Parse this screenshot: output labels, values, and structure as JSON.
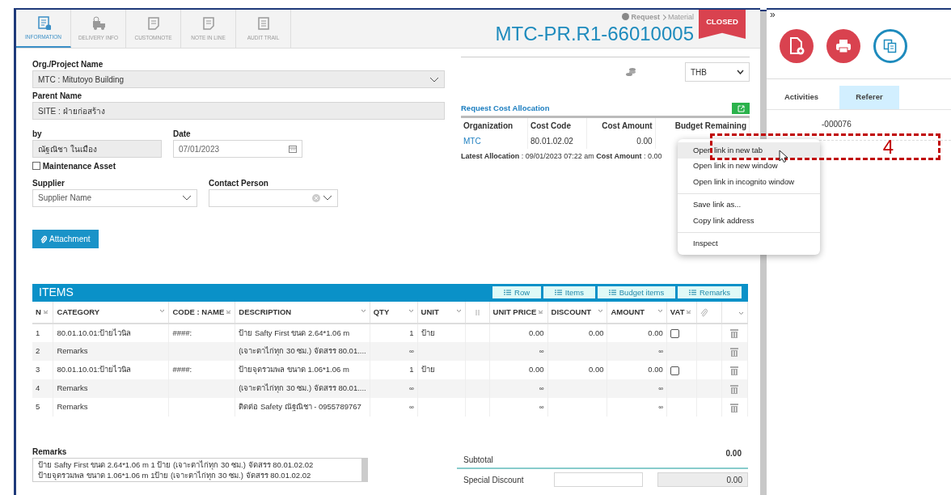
{
  "tabs": [
    {
      "label": "INFORMATION",
      "selected": true
    },
    {
      "label": "DELIVERY INFO",
      "selected": false
    },
    {
      "label": "CUSTOMNOTE",
      "selected": false
    },
    {
      "label": "NOTE IN LINE",
      "selected": false
    },
    {
      "label": "AUDIT TRAIL",
      "selected": false
    }
  ],
  "header": {
    "breadcrumb_parent": "Request",
    "breadcrumb_child": "Material",
    "title": "MTC-PR.R1-66010005",
    "status": "CLOSED"
  },
  "form": {
    "org_label": "Org./Project Name",
    "org_value": "MTC : Mitutoyo Building",
    "parent_label": "Parent Name",
    "parent_value": "SITE : ฝ่ายก่อสร้าง",
    "by_label": "by",
    "by_value": "ณัฐณิชา ในเมือง",
    "date_label": "Date",
    "date_value": "07/01/2023",
    "maintenance": {
      "label": "Maintenance Asset",
      "checked": false
    },
    "supplier_label": "Supplier",
    "supplier_placeholder": "Supplier Name",
    "contact_label": "Contact Person",
    "attachment_button": "Attachment"
  },
  "currency": "THB",
  "cost_allocation": {
    "title": "Request Cost Allocation",
    "columns": [
      "Organization",
      "Cost Code",
      "Cost Amount",
      "Budget Remaining"
    ],
    "rows": [
      {
        "cells": [
          "MTC",
          "80.01.02.02",
          "0.00"
        ]
      }
    ],
    "latest": "**Latest Allocation** : 09/01/2023 07:22 am **Cost Amount** : 0.00"
  },
  "items": {
    "title": "ITEMS",
    "buttons": [
      "Row",
      "Items",
      "Budget items",
      "Remarks"
    ],
    "columns": [
      "N",
      "CATEGORY",
      "CODE : NAME",
      "DESCRIPTION",
      "QTY",
      "UNIT",
      "UNIT PRICE",
      "DISCOUNT",
      "AMOUNT",
      "VAT"
    ],
    "rows": [
      {
        "kind": "item",
        "n": "1",
        "category": "80.01.10.01:ป้ายไวนิล",
        "code": "####:",
        "description": "ป้าย Safty First ขนด 2.64*1.06 m",
        "qty": "1",
        "unit": "ป้าย",
        "unit_price": "0.00",
        "discount": "0.00",
        "amount": "0.00",
        "vat": false
      },
      {
        "kind": "remark",
        "n": "2",
        "category": "Remarks",
        "description": "(เจาะตาไก่ทุก 30 ซม.) จัดสรร 80.01....",
        "qty": "∞",
        "unit_price": "∞",
        "amount": "∞"
      },
      {
        "kind": "item",
        "n": "3",
        "category": "80.01.10.01:ป้ายไวนิล",
        "code": "####:",
        "description": "ป้ายจุดรวมพล ขนาด 1.06*1.06 m",
        "qty": "1",
        "unit": "ป้าย",
        "unit_price": "0.00",
        "discount": "0.00",
        "amount": "0.00",
        "vat": false
      },
      {
        "kind": "remark",
        "n": "4",
        "category": "Remarks",
        "description": "(เจาะตาไก่ทุก 30 ซม.) จัดสรร 80.01....",
        "qty": "∞",
        "unit_price": "∞",
        "amount": "∞"
      },
      {
        "kind": "remark",
        "n": "5",
        "category": "Remarks",
        "description": "ติดต่อ Safety ณัฐณิชา - 0955789767",
        "qty": "∞",
        "unit_price": "∞",
        "amount": "∞"
      }
    ]
  },
  "remarks": {
    "label": "Remarks",
    "lines": [
      "ป้าย Safty First ขนด 2.64*1.06 m 1 ป้าย (เจาะตาไก่ทุก 30 ซม.) จัดสรร 80.01.02.02",
      "ป้ายจุดรวมพล ขนาด 1.06*1.06 m 1ป้าย (เจาะตาไก่ทุก 30 ซม.) จัดสรร 80.01.02.02"
    ]
  },
  "totals": {
    "subtotal_label": "Subtotal",
    "subtotal": "0.00",
    "discount_label": "Special Discount",
    "discount": "0.00"
  },
  "side": {
    "collapse": "»",
    "tabs": [
      {
        "label": "Activities",
        "selected": false
      },
      {
        "label": "Referer",
        "selected": true
      }
    ],
    "referer_item": "-000076"
  },
  "context_menu": {
    "groups": [
      [
        {
          "label": "Open link in new tab",
          "hovered": true
        },
        {
          "label": "Open link in new window",
          "hovered": false
        },
        {
          "label": "Open link in incognito window",
          "hovered": false
        }
      ],
      [
        {
          "label": "Save link as...",
          "hovered": false
        },
        {
          "label": "Copy link address",
          "hovered": false
        }
      ],
      [
        {
          "label": "Inspect",
          "hovered": false
        }
      ]
    ]
  },
  "annotation": {
    "label": "4"
  }
}
